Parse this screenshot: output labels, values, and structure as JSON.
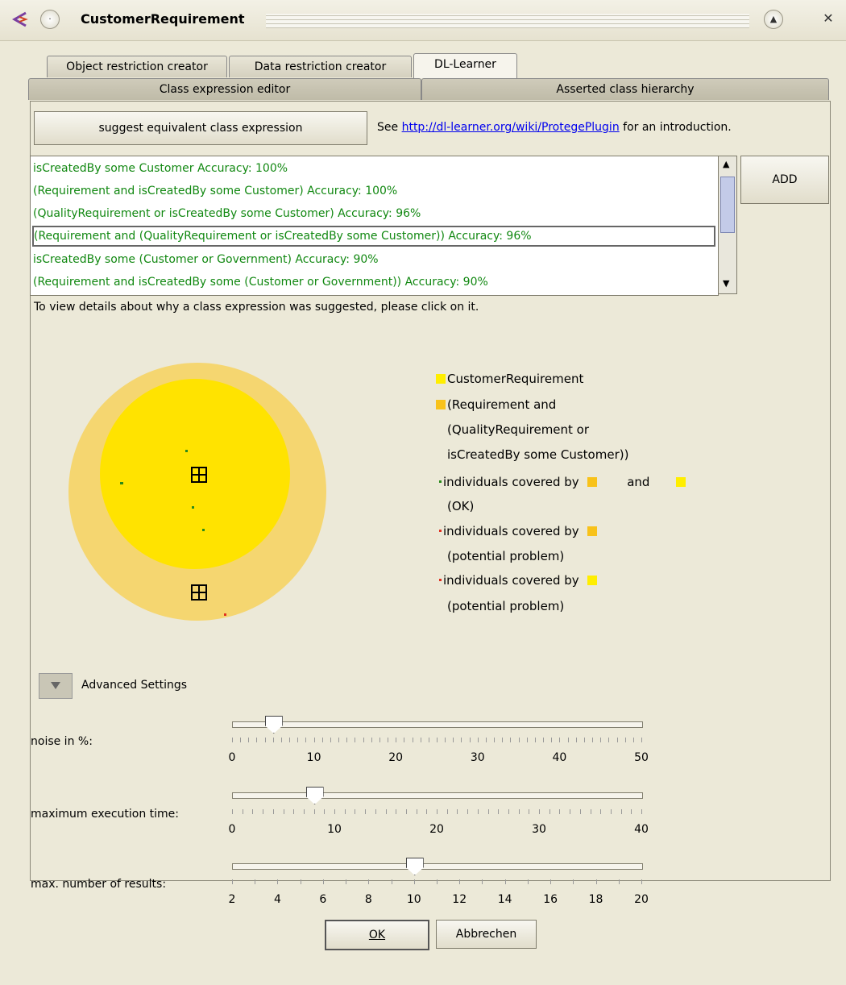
{
  "window": {
    "title": "CustomerRequirement"
  },
  "tabs_row1": [
    "Object restriction creator",
    "Data restriction creator",
    "DL-Learner"
  ],
  "tabs_row2": [
    "Class expression editor",
    "Asserted class hierarchy"
  ],
  "suggest_button": "suggest equivalent class expression",
  "see_prefix": "See",
  "see_link": "http://dl-learner.org/wiki/ProtegePlugin",
  "see_suffix": "for an introduction.",
  "results": [
    "isCreatedBy some Customer  Accuracy: 100%",
    "(Requirement and isCreatedBy some Customer)  Accuracy: 100%",
    "(QualityRequirement or isCreatedBy some Customer)  Accuracy: 96%",
    "(Requirement and (QualityRequirement or isCreatedBy some Customer))  Accuracy: 96%",
    "isCreatedBy some (Customer or Government)  Accuracy: 90%",
    "(Requirement and isCreatedBy some (Customer or Government))  Accuracy: 90%"
  ],
  "selected_result_index": 3,
  "add_button": "ADD",
  "hint": "To view details about why a class expression was suggested, please click on it.",
  "legend": {
    "class1": "CustomerRequirement",
    "class2_lines": [
      "(Requirement and",
      "(QualityRequirement or",
      "isCreatedBy some Customer))"
    ],
    "ok_line1": "individuals covered by",
    "ok_and": "and",
    "ok_line2": "(OK)",
    "prob1_line1": "individuals covered by",
    "prob1_line2": "(potential problem)",
    "prob2_line1": "individuals covered by",
    "prob2_line2": "(potential problem)"
  },
  "colors": {
    "outer_circle": "#f5d670",
    "inner_circle": "#ffe300",
    "legend_orange": "#f8c21a",
    "legend_yellow": "#ffee00",
    "ok_dot": "#2a8a1a",
    "problem_dot": "#e03020",
    "result_text": "#118811"
  },
  "advanced_settings": "Advanced Settings",
  "sliders": [
    {
      "label": "noise in %:",
      "min": 0,
      "max": 50,
      "value": 5,
      "labels": [
        "0",
        "10",
        "20",
        "30",
        "40",
        "50"
      ],
      "minor": 50
    },
    {
      "label": "maximum execution time:",
      "min": 0,
      "max": 40,
      "value": 8,
      "labels": [
        "0",
        "10",
        "20",
        "30",
        "40"
      ],
      "minor": 40
    },
    {
      "label": "max. number of results:",
      "min": 2,
      "max": 20,
      "value": 10,
      "labels": [
        "2",
        "4",
        "6",
        "8",
        "10",
        "12",
        "14",
        "16",
        "18",
        "20"
      ],
      "minor": 18
    }
  ],
  "ok_button": "OK",
  "cancel_button": "Abbrechen"
}
